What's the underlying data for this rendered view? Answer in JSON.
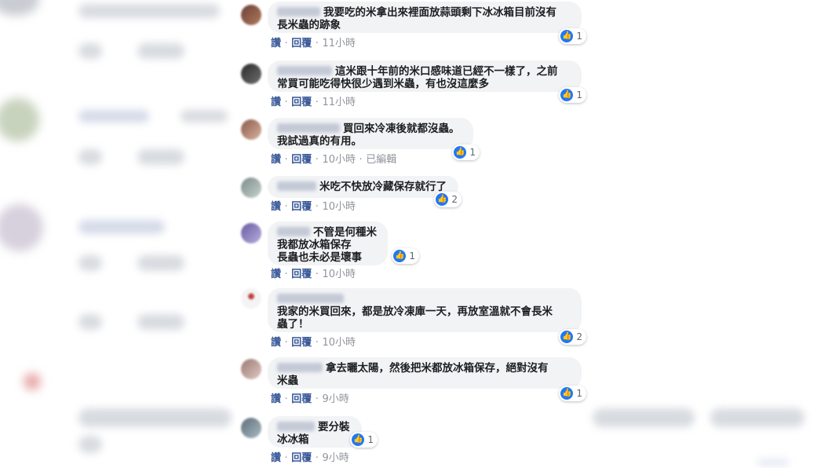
{
  "actions": {
    "like": "讚",
    "reply": "回覆",
    "dot": "·"
  },
  "comments": [
    {
      "lines": [
        "我要吃的米拿出來裡面放蒜頭剩下冰冰箱目前沒有",
        "長米蟲的跡象"
      ],
      "likes": "1",
      "time": "11小時",
      "edited": ""
    },
    {
      "lines": [
        "這米跟十年前的米口感味道已經不一樣了，之前",
        "常買可能吃得快很少遇到米蟲，有也沒這麼多"
      ],
      "likes": "1",
      "time": "11小時",
      "edited": ""
    },
    {
      "lines": [
        "買回來冷凍後就都沒蟲。",
        "我試過真的有用。"
      ],
      "likes": "1",
      "time": "10小時",
      "edited": "已編輯"
    },
    {
      "lines": [
        "米吃不快放冷藏保存就行了"
      ],
      "likes": "2",
      "time": "10小時",
      "edited": ""
    },
    {
      "lines": [
        "不管是何種米",
        "我都放冰箱保存",
        "長蟲也未必是壞事"
      ],
      "likes": "1",
      "time": "10小時",
      "edited": ""
    },
    {
      "lines": [
        "",
        "我家的米買回來，都是放冷凍庫一天，再放室溫就不會長米",
        "蟲了！"
      ],
      "likes": "2",
      "time": "10小時",
      "edited": ""
    },
    {
      "lines": [
        "拿去曬太陽，然後把米都放冰箱保存，絕對沒有",
        "米蟲"
      ],
      "likes": "1",
      "time": "9小時",
      "edited": ""
    },
    {
      "lines": [
        "要分裝",
        "冰冰箱"
      ],
      "likes": "1",
      "time": "9小時",
      "edited": ""
    }
  ],
  "colors": {
    "link": "#385898",
    "like_blue": "#2078f4",
    "bubble": "#f2f3f5"
  }
}
